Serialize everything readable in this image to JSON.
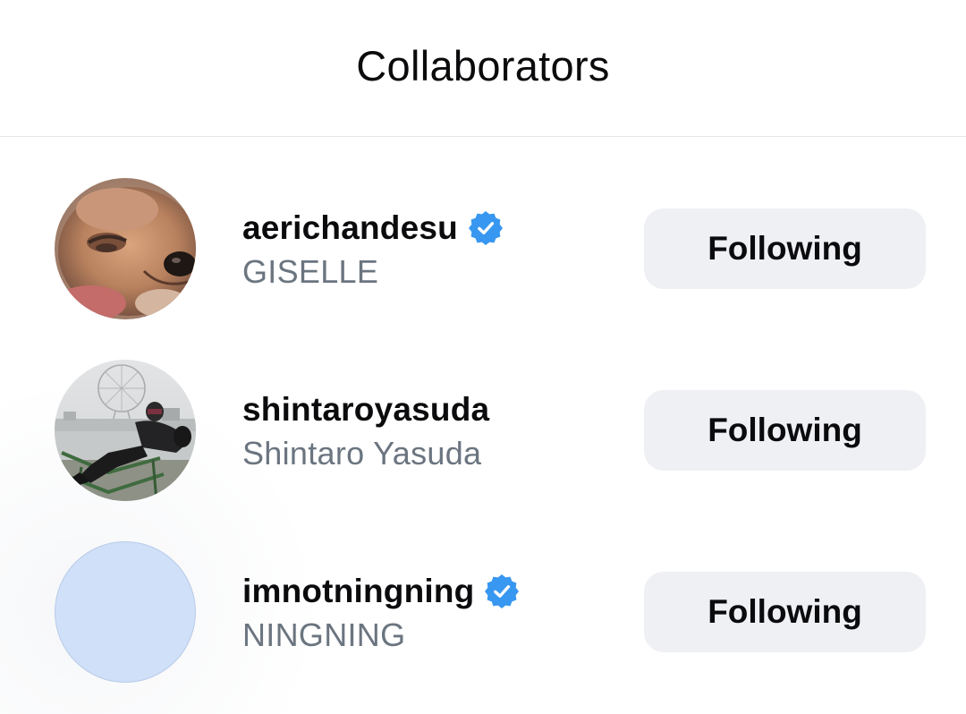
{
  "dialog": {
    "title": "Collaborators"
  },
  "collaborators": [
    {
      "username": "aerichandesu",
      "display_name": "GISELLE",
      "verified": true,
      "button_label": "Following",
      "avatar": "chihuahua-photo"
    },
    {
      "username": "shintaroyasuda",
      "display_name": "Shintaro Yasuda",
      "verified": false,
      "button_label": "Following",
      "avatar": "person-on-bench-ferris-wheel-photo"
    },
    {
      "username": "imnotningning",
      "display_name": "NINGNING",
      "verified": true,
      "button_label": "Following",
      "avatar": "blank-light-blue"
    }
  ],
  "colors": {
    "verified_blue": "#3897f0",
    "button_bg": "#eff0f3",
    "secondary_text": "#6b7580",
    "placeholder_avatar": "#cfe0f8"
  }
}
